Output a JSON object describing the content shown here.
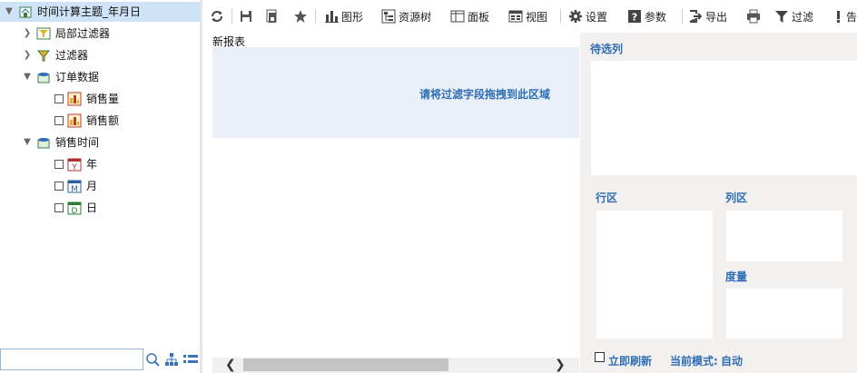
{
  "tree": {
    "root": "时间计算主题_年月日",
    "items": [
      {
        "label": "局部过滤器"
      },
      {
        "label": "过滤器"
      },
      {
        "label": "订单数据"
      },
      {
        "label": "销售量"
      },
      {
        "label": "销售额"
      },
      {
        "label": "销售时间"
      },
      {
        "label": "年",
        "icon_letter": "Y"
      },
      {
        "label": "月",
        "icon_letter": "M"
      },
      {
        "label": "日",
        "icon_letter": "D"
      }
    ]
  },
  "search": {
    "placeholder": ""
  },
  "toolbar": {
    "chart": "图形",
    "resource_tree": "资源树",
    "panel": "面板",
    "view": "视图",
    "settings": "设置",
    "params": "参数",
    "export": "导出",
    "filter": "过滤",
    "alert": "告"
  },
  "report": {
    "title": "新报表",
    "drop_hint": "请将过滤字段拖拽到此区域"
  },
  "right_panel": {
    "candidates": "待选列",
    "rows": "行区",
    "columns": "列区",
    "measures": "度量",
    "refresh_now": "立即刷新",
    "mode_label": "当前模式:",
    "mode_value": "自动"
  },
  "colors": {
    "accent": "#2f6db5",
    "selected": "#cfe3f7",
    "drop_bg": "#e9f0f8",
    "panel_bg": "#f2f1ef"
  }
}
